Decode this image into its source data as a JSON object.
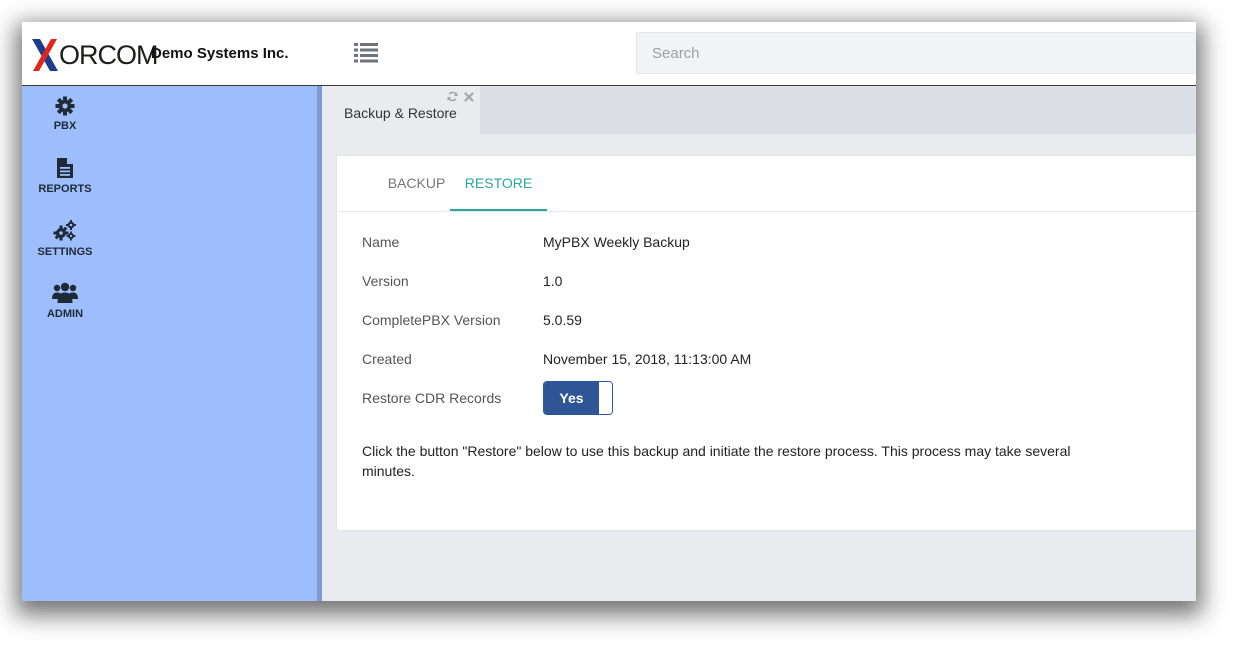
{
  "brand": {
    "logo_text": "ORCOM",
    "company": "Demo Systems Inc.",
    "colors": {
      "logo_red": "#e1251b",
      "logo_blue": "#1f3c8a"
    }
  },
  "header": {
    "menu_icon": "list-icon",
    "search": {
      "placeholder": "Search",
      "value": ""
    }
  },
  "sidebar": {
    "items": [
      {
        "label": "PBX",
        "icon": "gear-icon"
      },
      {
        "label": "REPORTS",
        "icon": "document-icon"
      },
      {
        "label": "SETTINGS",
        "icon": "gears-icon"
      },
      {
        "label": "ADMIN",
        "icon": "users-icon"
      }
    ],
    "colors": {
      "background": "#9dbdfd"
    }
  },
  "tabs": [
    {
      "label": "Backup & Restore",
      "actions": [
        "refresh-icon",
        "close-icon"
      ]
    }
  ],
  "panel": {
    "tabs": [
      {
        "label": "BACKUP",
        "active": false
      },
      {
        "label": "RESTORE",
        "active": true
      }
    ],
    "fields": [
      {
        "label": "Name",
        "value": "MyPBX Weekly Backup"
      },
      {
        "label": "Version",
        "value": "1.0"
      },
      {
        "label": "CompletePBX Version",
        "value": "5.0.59"
      },
      {
        "label": "Created",
        "value": "November 15, 2018, 11:13:00 AM"
      }
    ],
    "restore_cdr": {
      "label": "Restore CDR Records",
      "value": "Yes",
      "on": true
    },
    "note": "Click the button \"Restore\" below to use this backup and initiate the restore process. This process may take several minutes.",
    "colors": {
      "accent": "#2aa79c",
      "toggle": "#2e5697"
    }
  }
}
